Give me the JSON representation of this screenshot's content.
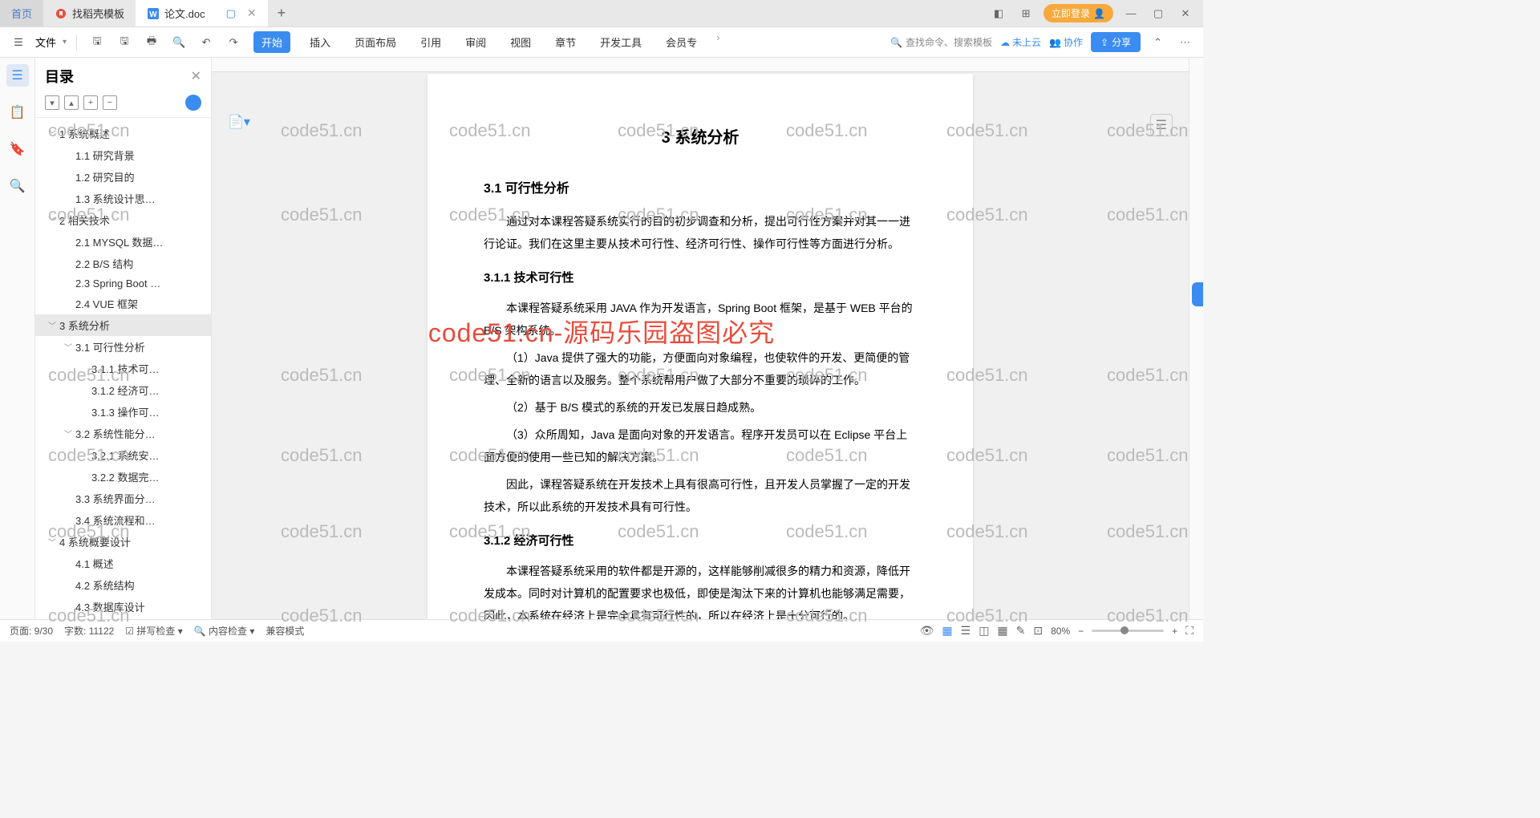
{
  "tabs": {
    "home": "首页",
    "template": "找稻壳模板",
    "doc": "论文.doc"
  },
  "login": "立即登录",
  "menu": {
    "file": "文件",
    "items": [
      "开始",
      "插入",
      "页面布局",
      "引用",
      "审阅",
      "视图",
      "章节",
      "开发工具",
      "会员专"
    ],
    "search": "查找命令、搜索模板",
    "cloud": "未上云",
    "collab": "协作",
    "share": "分享"
  },
  "outline": {
    "title": "目录",
    "items": [
      {
        "l": 1,
        "t": "1 系统概述",
        "c": true
      },
      {
        "l": 2,
        "t": "1.1 研究背景"
      },
      {
        "l": 2,
        "t": "1.2 研究目的"
      },
      {
        "l": 2,
        "t": "1.3 系统设计思…"
      },
      {
        "l": 1,
        "t": "2 相关技术",
        "c": true
      },
      {
        "l": 2,
        "t": "2.1 MYSQL 数据…"
      },
      {
        "l": 2,
        "t": "2.2 B/S 结构"
      },
      {
        "l": 2,
        "t": "2.3 Spring Boot …"
      },
      {
        "l": 2,
        "t": "2.4 VUE 框架"
      },
      {
        "l": 1,
        "t": "3 系统分析",
        "c": true,
        "sel": true
      },
      {
        "l": 2,
        "t": "3.1 可行性分析",
        "c": true
      },
      {
        "l": 3,
        "t": "3.1.1 技术可…"
      },
      {
        "l": 3,
        "t": "3.1.2 经济可…"
      },
      {
        "l": 3,
        "t": "3.1.3 操作可…"
      },
      {
        "l": 2,
        "t": "3.2 系统性能分…",
        "c": true
      },
      {
        "l": 3,
        "t": "3.2.1 系统安…"
      },
      {
        "l": 3,
        "t": "3.2.2 数据完…"
      },
      {
        "l": 2,
        "t": "3.3 系统界面分…"
      },
      {
        "l": 2,
        "t": "3.4 系统流程和…"
      },
      {
        "l": 1,
        "t": "4 系统概要设计",
        "c": true
      },
      {
        "l": 2,
        "t": "4.1 概述"
      },
      {
        "l": 2,
        "t": "4.2 系统结构"
      },
      {
        "l": 2,
        "t": "4.3 数据库设计"
      }
    ]
  },
  "doc": {
    "h1": "3 系统分析",
    "h2_1": "3.1 可行性分析",
    "p1": "通过对本课程答疑系统实行的目的初步调查和分析，提出可行性方案并对其一一进行论证。我们在这里主要从技术可行性、经济可行性、操作可行性等方面进行分析。",
    "h3_1": "3.1.1 技术可行性",
    "p2": "本课程答疑系统采用 JAVA 作为开发语言，Spring Boot 框架，是基于 WEB 平台的 B/S 架构系统。",
    "p3": "（1）Java 提供了强大的功能，方便面向对象编程，也使软件的开发、更简便的管理、全新的语言以及服务。整个系统帮用户做了大部分不重要的琐碎的工作。",
    "p4": "（2）基于 B/S 模式的系统的开发已发展日趋成熟。",
    "p5": "（3）众所周知，Java 是面向对象的开发语言。程序开发员可以在 Eclipse 平台上面方便的使用一些已知的解决方案。",
    "p6": "因此，课程答疑系统在开发技术上具有很高可行性，且开发人员掌握了一定的开发技术，所以此系统的开发技术具有可行性。",
    "h3_2": "3.1.2 经济可行性",
    "p7": "本课程答疑系统采用的软件都是开源的，这样能够削减很多的精力和资源，降低开发成本。同时对计算机的配置要求也极低，即使是淘汰下来的计算机也能够满足需要，因此，本系统在经济上是完全具有可行性的，所以在经济上是十分可行的。"
  },
  "status": {
    "page": "页面: 9/30",
    "words": "字数: 11122",
    "spell": "拼写检查",
    "content": "内容检查",
    "compat": "兼容模式",
    "zoom": "80%"
  },
  "watermark": "code51.cn",
  "watermark_center": "code51.cn-源码乐园盗图必究"
}
